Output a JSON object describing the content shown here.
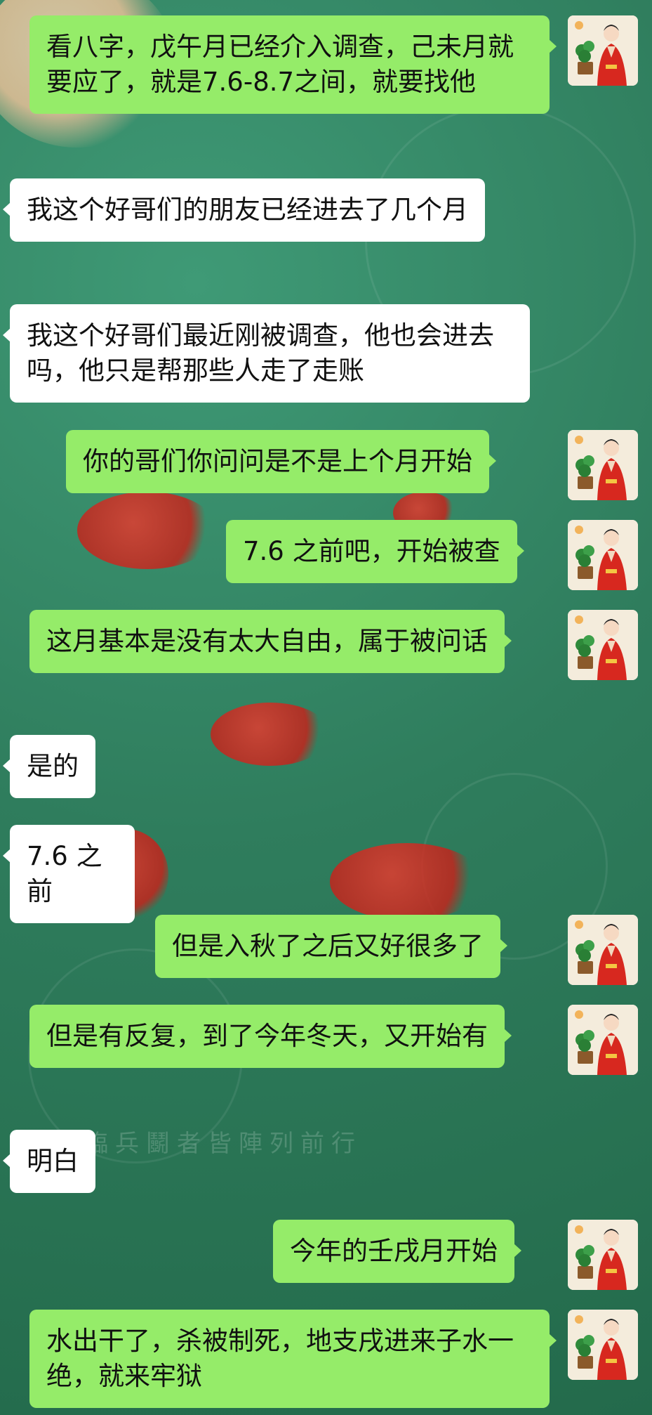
{
  "chat": {
    "messages": [
      {
        "side": "out",
        "text": "看八字，戊午月已经介入调查，己未月就要应了，就是7.6-8.7之间，就要找他"
      },
      {
        "side": "in",
        "text": "我这个好哥们的朋友已经进去了几个月"
      },
      {
        "side": "in",
        "text": "我这个好哥们最近刚被调查，他也会进去吗，他只是帮那些人走了走账"
      },
      {
        "side": "out",
        "text": "你的哥们你问问是不是上个月开始"
      },
      {
        "side": "out",
        "text": "7.6 之前吧，开始被查"
      },
      {
        "side": "out",
        "text": "这月基本是没有太大自由，属于被问话"
      },
      {
        "side": "in",
        "text": "是的"
      },
      {
        "side": "in",
        "text": "7.6 之前"
      },
      {
        "side": "out",
        "text": "但是入秋了之后又好很多了"
      },
      {
        "side": "out",
        "text": "但是有反复，到了今年冬天，又开始有"
      },
      {
        "side": "in",
        "text": "明白"
      },
      {
        "side": "out",
        "text": "今年的壬戌月开始"
      },
      {
        "side": "out",
        "text": "水出干了，杀被制死，地支戌进来子水一绝，就来牢狱"
      }
    ]
  },
  "colors": {
    "background": "#2f7d5d",
    "bubble_out": "#95ec69",
    "bubble_in": "#ffffff"
  },
  "background_watermark": "臨兵鬭者皆陣列前行",
  "avatar_icon": "woman-in-red-hanfu-avatar"
}
